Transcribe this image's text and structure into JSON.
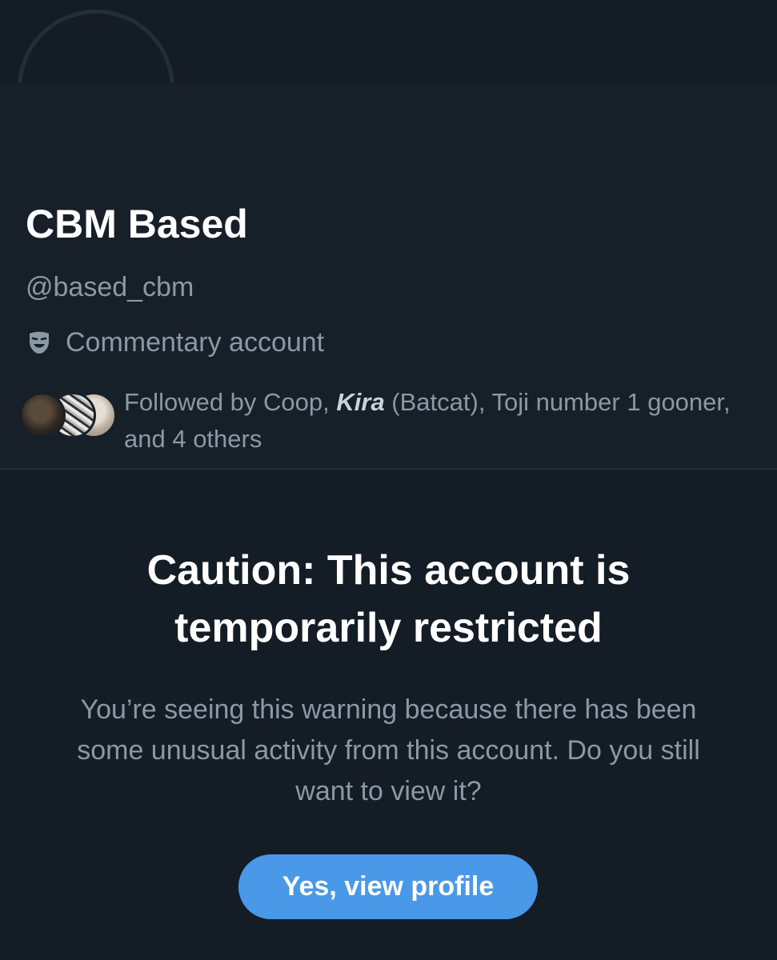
{
  "profile": {
    "display_name": "CBM Based",
    "handle": "@based_cbm",
    "label": "Commentary account",
    "label_icon": "theater-mask-icon",
    "followed_by": {
      "prefix": "Followed by Coop, ",
      "highlight": "Kira",
      "suffix": " (Batcat), Toji number 1 gooner, and 4 others"
    }
  },
  "caution": {
    "title": "Caution: This account is temporarily restricted",
    "body": "You’re seeing this warning because there has been some unusual activity from this account. Do you still want to view it?",
    "button_label": "Yes, view profile"
  },
  "colors": {
    "background": "#15202b",
    "text_secondary": "#8b98a5",
    "accent_button": "#4a99e9"
  }
}
